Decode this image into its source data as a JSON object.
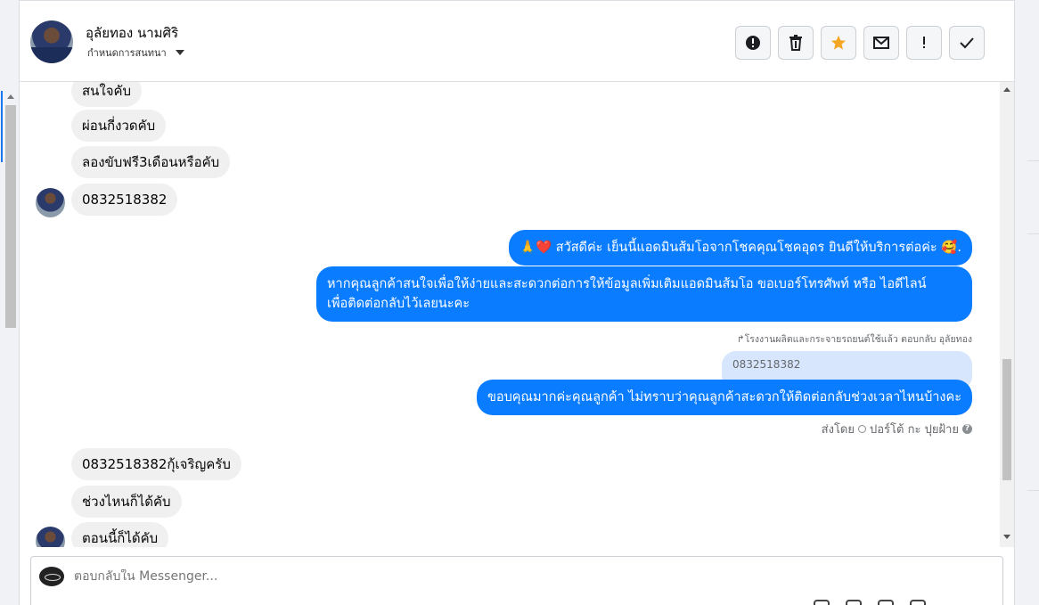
{
  "header": {
    "contact_name": "อุลัยทอง นามศิริ",
    "contact_sub": "กำหนดการสนทนา"
  },
  "actions": [
    {
      "icon": "alert-circle-icon"
    },
    {
      "icon": "trash-icon"
    },
    {
      "icon": "star-icon",
      "color": "#f5a623"
    },
    {
      "icon": "envelope-icon"
    },
    {
      "icon": "exclamation-icon"
    },
    {
      "icon": "checkmark-icon"
    }
  ],
  "messages": {
    "in_1": "สนใจคับ",
    "in_2": "ผ่อนกี่งวดคับ",
    "in_3": "ลองขับฟรี3เดือนหรือคับ",
    "in_4": "0832518382",
    "out_1": "🙏❤️ สวัสดีค่ะ เย็นนี้แอดมินส้มโอจากโชคคุณโชคอุดร ยินดีให้บริการต่อค่ะ 🥰.",
    "out_2_line1": "หากคุณลูกค้าสนใจเพื่อให้ง่ายและสะดวกต่อการให้ข้อมูลเพิ่มเติมแอดมินส้มโอ ขอเบอร์โทรศัพท์ หรือ ไอดีไลน์",
    "out_2_line2": "เพื่อติดต่อกลับไว้เลยนะคะ",
    "reply_meta": "↱โรงงานผลิตและกระจายรถยนต์ใช้แล้ว ตอบกลับ อุลัยทอง",
    "quoted": "0832518382",
    "out_3": "ขอบคุณมากค่ะคุณลูกค้า ไม่ทราบว่าคุณลูกค้าสะดวกให้ติดต่อกลับช่วงเวลาไหนบ้างคะ",
    "sent_by_label": "ส่งโดย",
    "sent_by_name": "ปอร์โต้ กะ ปุยฝ้าย",
    "in_5": "0832518382กุ้เจริญครับ",
    "in_6": "ช่วงไหนก็ได้คับ",
    "in_7": "ตอนนี้ก็ได้คับ"
  },
  "composer": {
    "placeholder": "ตอบกลับใน Messenger..."
  },
  "colors": {
    "outgoing_bubble": "#0a7cff",
    "incoming_bubble": "#f0f0f0",
    "accent": "#1877f2"
  }
}
